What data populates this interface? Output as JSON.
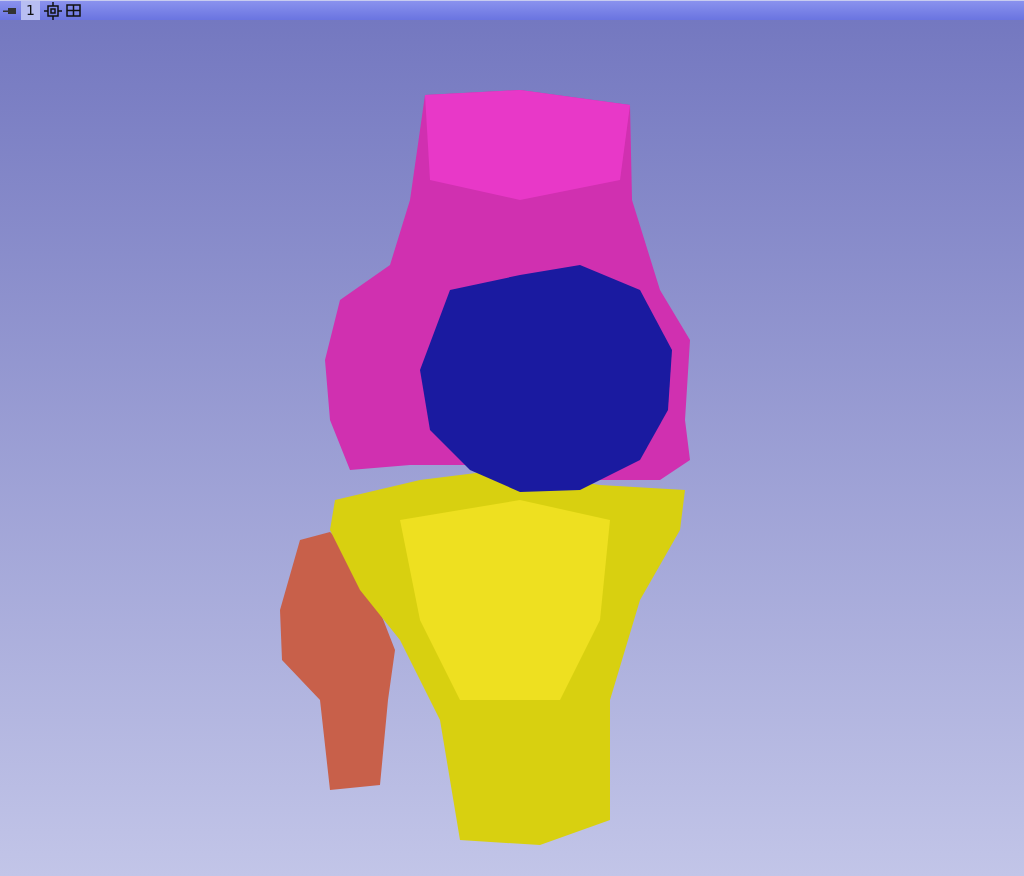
{
  "view_bar": {
    "view_label": "1"
  }
}
